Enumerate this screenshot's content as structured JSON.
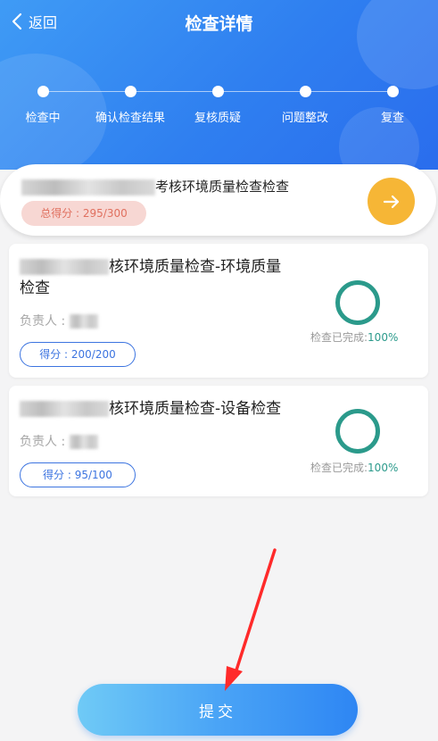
{
  "header": {
    "back_label": "返回",
    "title": "检查详情",
    "steps": [
      "检查中",
      "确认检查结果",
      "复核质疑",
      "问题整改",
      "复查"
    ]
  },
  "summary": {
    "name_suffix": "考核环境质量检查检查",
    "total_score": "总得分 : 295/300"
  },
  "cards": [
    {
      "title_suffix": "核环境质量检查-环境质量",
      "title_line2": "检查",
      "owner_label": "负责人 :",
      "score": "得分 : 200/200",
      "progress_label": "检查已完成:",
      "progress_pct": "100%"
    },
    {
      "title_suffix": "核环境质量检查-设备检查",
      "owner_label": "负责人 :",
      "score": "得分 : 95/100",
      "progress_label": "检查已完成:",
      "progress_pct": "100%"
    }
  ],
  "submit_label": "提交",
  "colors": {
    "header_blue": "#2f7ff0",
    "accent_orange": "#f6b636",
    "ring_green": "#2b9a8b",
    "score_blue": "#3c74e0",
    "annotation_red": "#ff2a2a"
  }
}
